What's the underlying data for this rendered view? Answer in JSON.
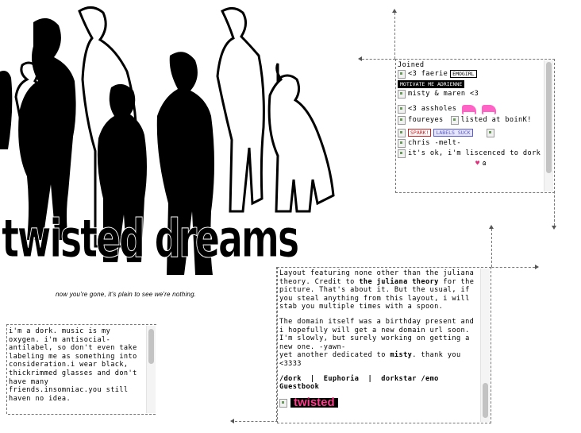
{
  "header": {
    "title": "twisted dreams",
    "tagline": "now you're gone, it's plain to see we're nothing."
  },
  "friends": {
    "heading": "Joined",
    "items": [
      {
        "label": "<3 faerie",
        "tag": "EMOGIRL"
      },
      {
        "label": "",
        "tag": "MOTIVATE ME ADRIENNE"
      },
      {
        "label": "misty & maren <3"
      },
      {
        "label": "<3 assholes"
      },
      {
        "label": "foureyes",
        "second": "listed at boinK!"
      },
      {
        "label": "",
        "tag": "LABELS SUCK",
        "sparkle": "SPARK!"
      },
      {
        "label": "chris -melt-"
      },
      {
        "label": "it's ok, i'm liscenced to dork"
      }
    ]
  },
  "about": {
    "text": "i'm a dork. music is my oxygen. i'm antisocial-antilabel, so don't even take labeling me as something into consideration.i wear black, thickrimmed glasses and don't have many friends.insomniac.you still haven no idea."
  },
  "info": {
    "p1_a": "Layout featuring none other than the juliana theory.  Credit to ",
    "p1_b": "the juliana theory",
    "p1_c": " for the picture. That's about it. But the usual, if you steal anything from this layout, i will stab you multiple times with a spoon.",
    "p2_a": "The domain itself was a birthday present and i hopefully will get a new domain url soon. I'm slowly, but surely working on getting a new one. -yawn-",
    "p2_b": "yet another dedicated to ",
    "p2_c": "misty",
    "p2_d": ". thank you <3333",
    "links": [
      "/dork",
      "Euphoria",
      "dorkstar /emo",
      "Guestbook"
    ],
    "link_sep": "|",
    "banner": "twisted"
  }
}
